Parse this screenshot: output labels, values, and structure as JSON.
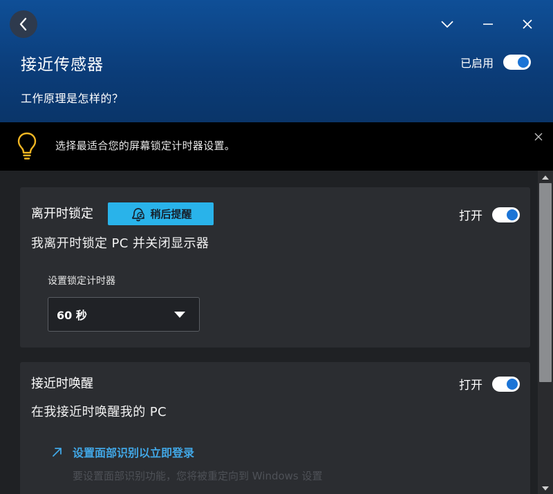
{
  "header": {
    "title": "接近传感器",
    "how_link": "工作原理是怎样的？",
    "enabled_label": "已启用",
    "enabled": true,
    "back_icon": "chevron-left-icon",
    "window_controls": [
      "chevron-down-icon",
      "minimize-icon",
      "close-icon"
    ]
  },
  "tip": {
    "text": "选择最适合您的屏幕锁定计时器设置。",
    "icon": "lightbulb-icon",
    "icon_color": "#f2b623"
  },
  "lock_card": {
    "title": "离开时锁定",
    "snooze_label": "稍后提醒",
    "snooze_color": "#29b3ea",
    "description": "我离开时锁定 PC 并关闭显示器",
    "toggle_label": "打开",
    "toggle_on": true,
    "timer_label": "设置锁定计时器",
    "timer_value": "60 秒"
  },
  "wake_card": {
    "title": "接近时唤醒",
    "description": "在我接近时唤醒我的 PC",
    "toggle_label": "打开",
    "toggle_on": true,
    "face_link": "设置面部识别以立即登录",
    "face_desc": "要设置面部识别功能，您将被重定向到 Windows 设置"
  },
  "colors": {
    "header_blue": "#0f4f97",
    "accent": "#1b74d6",
    "link": "#41a7e6",
    "background": "#1f2124",
    "card": "#2b2d31"
  }
}
